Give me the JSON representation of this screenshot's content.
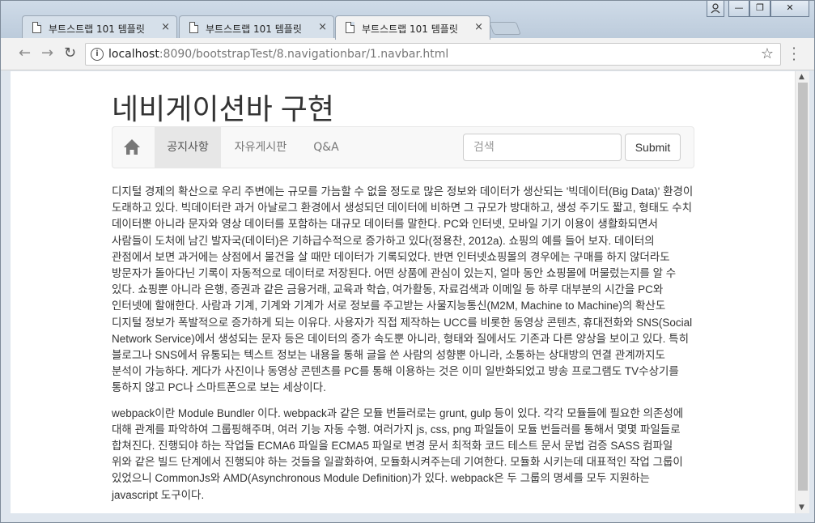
{
  "browser": {
    "tabs": [
      {
        "title": "부트스트랩 101 템플릿",
        "close": "×"
      },
      {
        "title": "부트스트랩 101 템플릿",
        "close": "×"
      },
      {
        "title": "부트스트랩 101 템플릿",
        "close": "×"
      }
    ],
    "url_host": "localhost",
    "url_rest": ":8090/bootstrapTest/8.navigationbar/1.navbar.html",
    "window_controls": {
      "minimize": "—",
      "restore": "❐",
      "close": "✕"
    }
  },
  "page": {
    "title": "네비게이션바 구현",
    "navbar": {
      "home_icon": "home-icon",
      "items": [
        "공지사항",
        "자유게시판",
        "Q&A"
      ],
      "active_index": 0,
      "search_placeholder": "검색",
      "submit_label": "Submit"
    },
    "paragraphs": [
      "디지털 경제의 확산으로 우리 주변에는 규모를 가늠할 수 없을 정도로 많은 정보와 데이터가 생산되는 '빅데이터(Big Data)' 환경이 도래하고 있다. 빅데이터란 과거 아날로그 환경에서 생성되던 데이터에 비하면 그 규모가 방대하고, 생성 주기도 짧고, 형태도 수치 데이터뿐 아니라 문자와 영상 데이터를 포함하는 대규모 데이터를 말한다. PC와 인터넷, 모바일 기기 이용이 생활화되면서 사람들이 도처에 남긴 발자국(데이터)은 기하급수적으로 증가하고 있다(정용찬, 2012a). 쇼핑의 예를 들어 보자. 데이터의 관점에서 보면 과거에는 상점에서 물건을 살 때만 데이터가 기록되었다. 반면 인터넷쇼핑몰의 경우에는 구매를 하지 않더라도 방문자가 돌아다닌 기록이 자동적으로 데이터로 저장된다. 어떤 상품에 관심이 있는지, 얼마 동안 쇼핑몰에 머물렀는지를 알 수 있다. 쇼핑뿐 아니라 은행, 증권과 같은 금융거래, 교육과 학습, 여가활동, 자료검색과 이메일 등 하루 대부분의 시간을 PC와 인터넷에 할애한다. 사람과 기계, 기계와 기계가 서로 정보를 주고받는 사물지능통신(M2M, Machine to Machine)의 확산도 디지털 정보가 폭발적으로 증가하게 되는 이유다. 사용자가 직접 제작하는 UCC를 비롯한 동영상 콘텐츠, 휴대전화와 SNS(Social Network Service)에서 생성되는 문자 등은 데이터의 증가 속도뿐 아니라, 형태와 질에서도 기존과 다른 양상을 보이고 있다. 특히 블로그나 SNS에서 유통되는 텍스트 정보는 내용을 통해 글을 쓴 사람의 성향뿐 아니라, 소통하는 상대방의 연결 관계까지도 분석이 가능하다. 게다가 사진이나 동영상 콘텐츠를 PC를 통해 이용하는 것은 이미 일반화되었고 방송 프로그램도 TV수상기를 통하지 않고 PC나 스마트폰으로 보는 세상이다.",
      "webpack이란 Module Bundler 이다. webpack과 같은 모듈 번들러로는 grunt, gulp 등이 있다. 각각 모듈들에 필요한 의존성에 대해 관계를 파악하여 그룹핑해주며, 여러 기능 자동 수행. 여러가지 js, css, png 파일들이 모듈 번들러를 통해서 몇몇 파일들로 합쳐진다. 진행되야 하는 작업들 ECMA6 파일을 ECMA5 파일로 변경 문서 최적화 코드 테스트 문서 문법 검증 SASS 컴파일 위와 같은 빌드 단계에서 진행되야 하는 것들을 일괄화하여, 모듈화시켜주는데 기여한다. 모듈화 시키는데 대표적인 작업 그룹이 있었으니 CommonJs와 AMD(Asynchronous Module Definition)가 있다. webpack은 두 그룹의 명세를 모두 지원하는 javascript 도구이다."
    ]
  }
}
